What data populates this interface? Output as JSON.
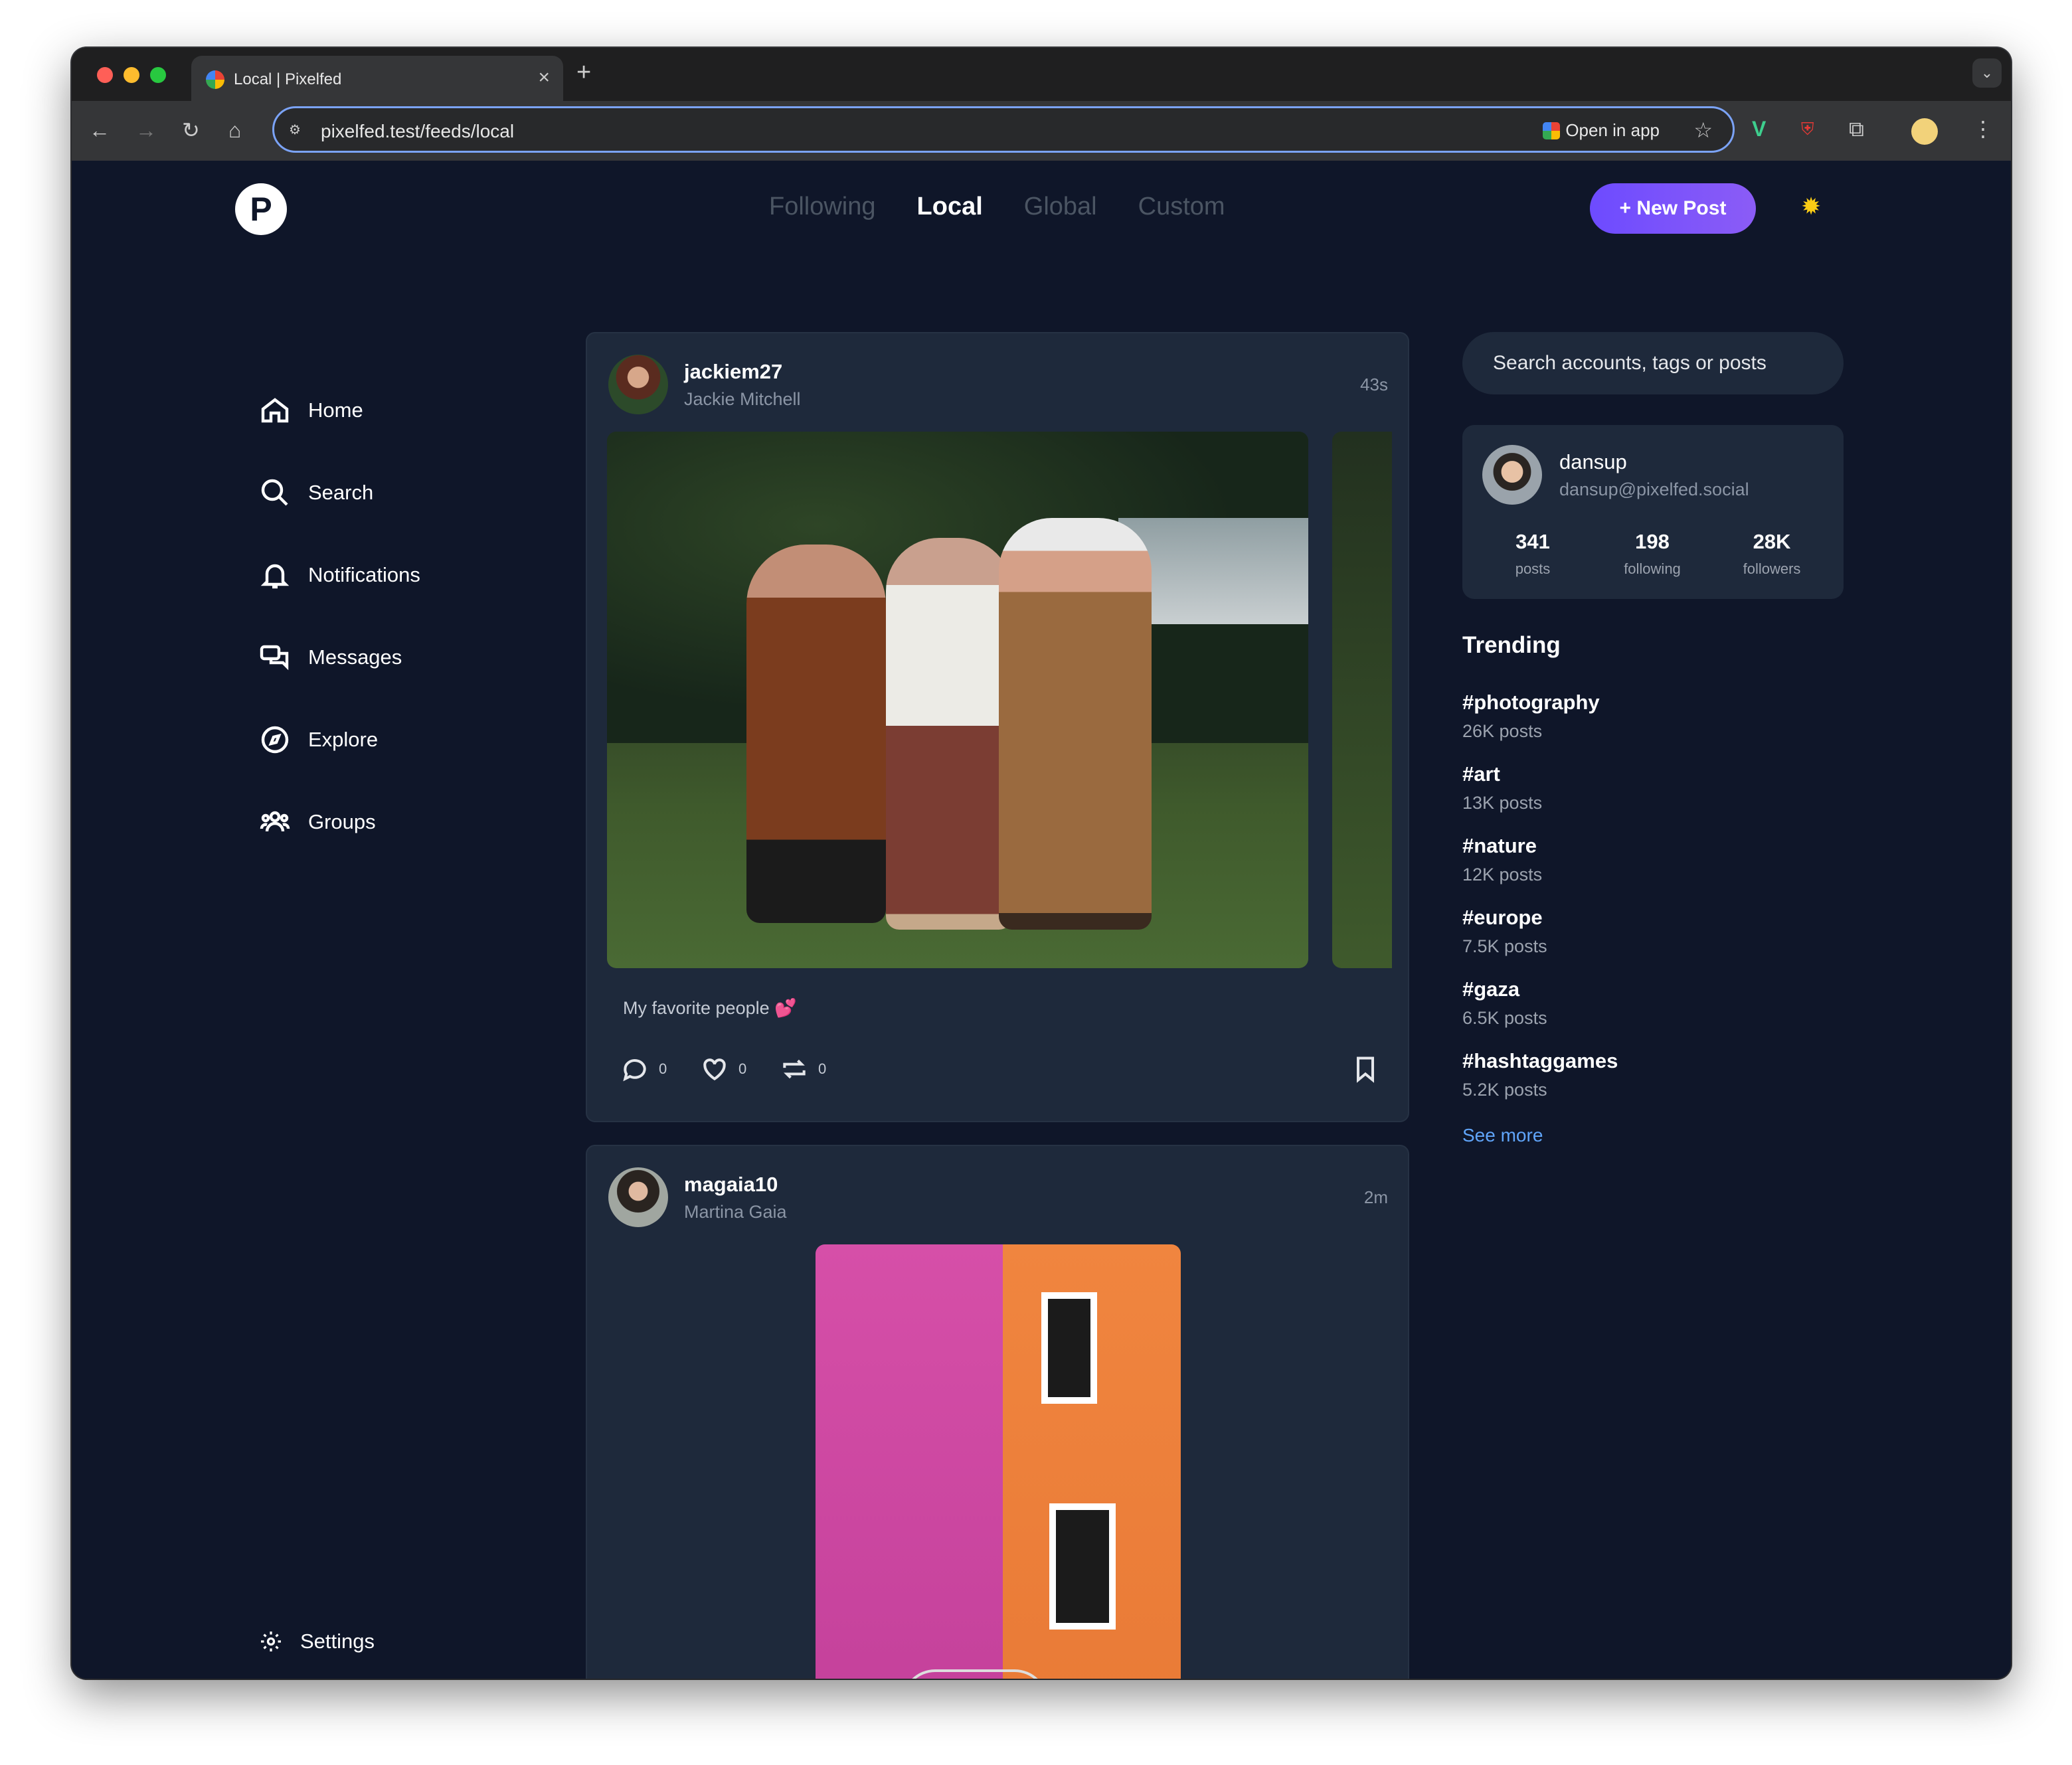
{
  "browser": {
    "tab_title": "Local | Pixelfed",
    "url": "pixelfed.test/feeds/local",
    "open_in_app": "Open in app"
  },
  "app": {
    "feed_tabs": [
      "Following",
      "Local",
      "Global",
      "Custom"
    ],
    "active_feed": "Local",
    "new_post_label": "New Post"
  },
  "sidebar": {
    "items": [
      {
        "label": "Home",
        "icon": "home-icon"
      },
      {
        "label": "Search",
        "icon": "search-icon"
      },
      {
        "label": "Notifications",
        "icon": "bell-icon"
      },
      {
        "label": "Messages",
        "icon": "messages-icon"
      },
      {
        "label": "Explore",
        "icon": "compass-icon"
      },
      {
        "label": "Groups",
        "icon": "groups-icon"
      }
    ],
    "settings_label": "Settings"
  },
  "posts": [
    {
      "username": "jackiem27",
      "display_name": "Jackie Mitchell",
      "time": "43s",
      "caption": "My favorite people 💕",
      "comments": "0",
      "likes": "0",
      "shares": "0"
    },
    {
      "username": "magaia10",
      "display_name": "Martina Gaia",
      "time": "2m"
    }
  ],
  "right": {
    "search_placeholder": "Search accounts, tags or posts",
    "profile": {
      "username": "dansup",
      "handle": "dansup@pixelfed.social",
      "posts": "341",
      "posts_label": "posts",
      "following": "198",
      "following_label": "following",
      "followers": "28K",
      "followers_label": "followers"
    },
    "trending_title": "Trending",
    "trending": [
      {
        "tag": "#photography",
        "count": "26K posts"
      },
      {
        "tag": "#art",
        "count": "13K posts"
      },
      {
        "tag": "#nature",
        "count": "12K posts"
      },
      {
        "tag": "#europe",
        "count": "7.5K posts"
      },
      {
        "tag": "#gaza",
        "count": "6.5K posts"
      },
      {
        "tag": "#hashtaggames",
        "count": "5.2K posts"
      }
    ],
    "see_more": "See more"
  },
  "colors": {
    "background": "#0f1629",
    "card": "#1e293b",
    "accent": "#7c4dff",
    "link": "#60a5fa"
  }
}
